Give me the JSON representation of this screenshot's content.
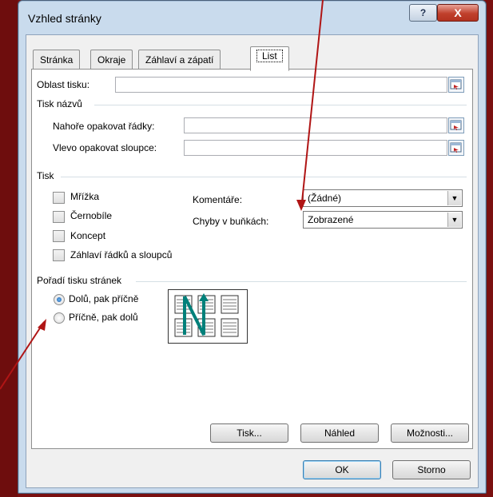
{
  "window": {
    "title": "Vzhled stránky",
    "help": "?",
    "close": "X"
  },
  "tabs": [
    {
      "label": "Stránka"
    },
    {
      "label": "Okraje"
    },
    {
      "label": "Záhlaví a zápatí"
    },
    {
      "label": "List"
    }
  ],
  "print_area": {
    "label": "Oblast tisku:",
    "value": ""
  },
  "print_titles": {
    "section": "Tisk názvů",
    "rows_label": "Nahoře opakovat řádky:",
    "rows_value": "",
    "cols_label": "Vlevo opakovat sloupce:",
    "cols_value": ""
  },
  "print": {
    "section": "Tisk",
    "gridlines": "Mřížka",
    "blackwhite": "Černobíle",
    "draft": "Koncept",
    "headings": "Záhlaví řádků a sloupců",
    "comments_label": "Komentáře:",
    "comments_value": "(Žádné)",
    "errors_label": "Chyby v buňkách:",
    "errors_value": "Zobrazené"
  },
  "page_order": {
    "section": "Pořadí tisku stránek",
    "down_then_over": "Dolů, pak příčně",
    "over_then_down": "Příčně, pak dolů",
    "selected": "down_then_over"
  },
  "buttons": {
    "print": "Tisk...",
    "preview": "Náhled",
    "options": "Možnosti...",
    "ok": "OK",
    "cancel": "Storno"
  },
  "colors": {
    "accent_arrow": "#b01515",
    "order_arrow": "#00807a"
  }
}
